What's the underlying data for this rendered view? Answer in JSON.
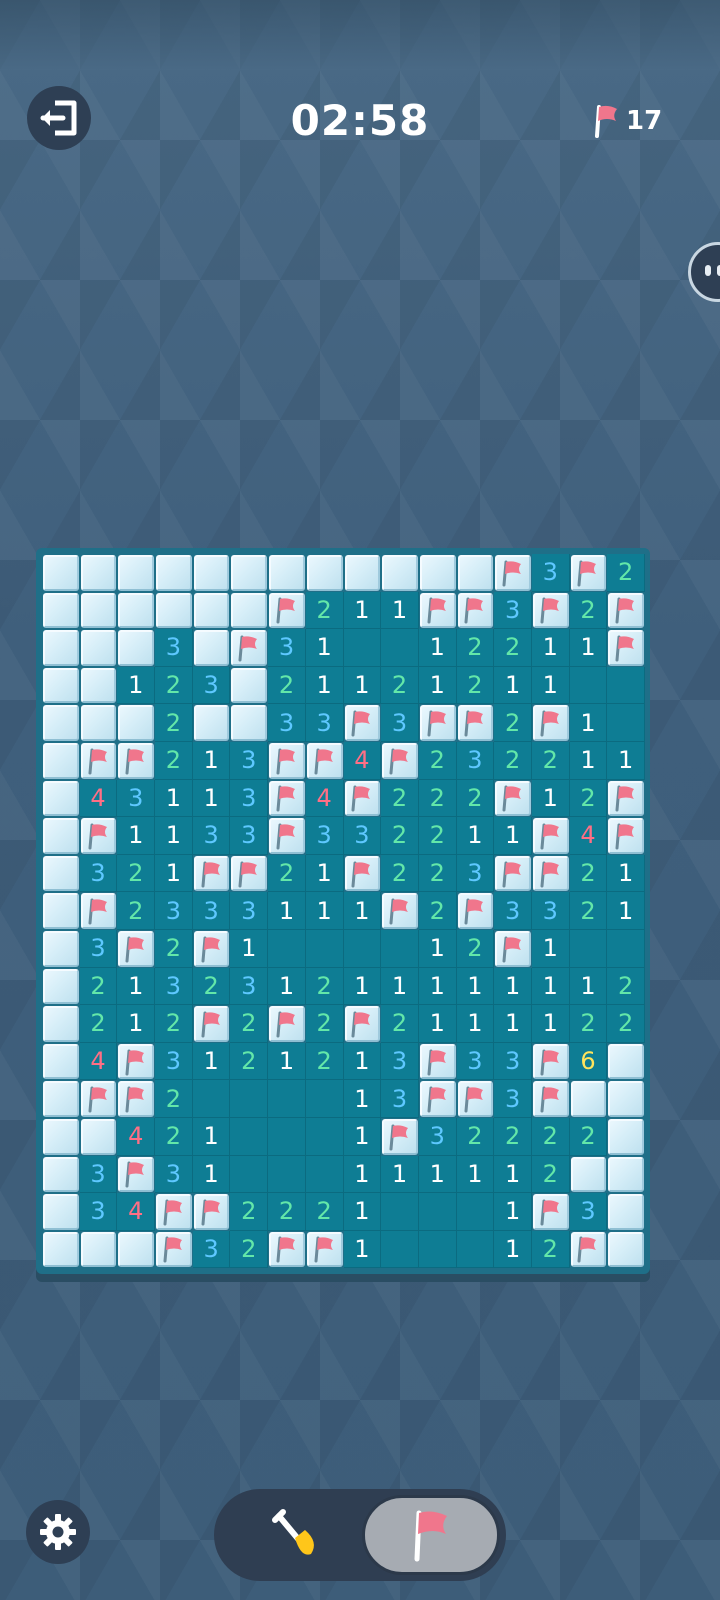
{
  "header": {
    "timer": "02:58",
    "flags_remaining": "17"
  },
  "icons": {
    "exit": "exit-icon",
    "flag": "flag-icon",
    "gear": "gear-icon",
    "shovel": "shovel-icon",
    "side_handle": "assistant-face-icon"
  },
  "colors": {
    "background": "#4a6a86",
    "board": "#1f6f88",
    "open_cell": "#0e7d94",
    "covered_cell": "#d6eef8",
    "flag": "#f0768c",
    "num_1": "#ffffff",
    "num_2": "#63e7a9",
    "num_3": "#5ec8ff",
    "num_4": "#ff6f85",
    "num_6": "#ffe45c"
  },
  "board": {
    "columns": 16,
    "rows_count": 19,
    "legend": {
      "#": "covered",
      "F": "flag",
      ".": "empty",
      "1-8": "number"
    },
    "rows": [
      "############F3F2",
      "######F211FF3F2F",
      "###3#F31..12211F",
      "##123#21121211..",
      "###2##33F3FF2F1.",
      "#FF213FF4F23221 1",
      "#43113F4F222F12F",
      "#F1133F332211F4F",
      "#321FF21F223FF21",
      "#F2333111F2F33 21.",
      "#3F2F1....12F1..",
      "#2132312111111122",
      "#212F2F2F2111122F",
      "#4F3121213F33F6#",
      "#FF2....13FF3F##",
      "##421...1F32222##",
      "#3F31...11111 2##",
      "#34FF2221...1F3##",
      "###F32FF1...12F##"
    ]
  },
  "controls": {
    "mode_dig": "dig",
    "mode_flag": "flag",
    "active_mode": "flag"
  }
}
